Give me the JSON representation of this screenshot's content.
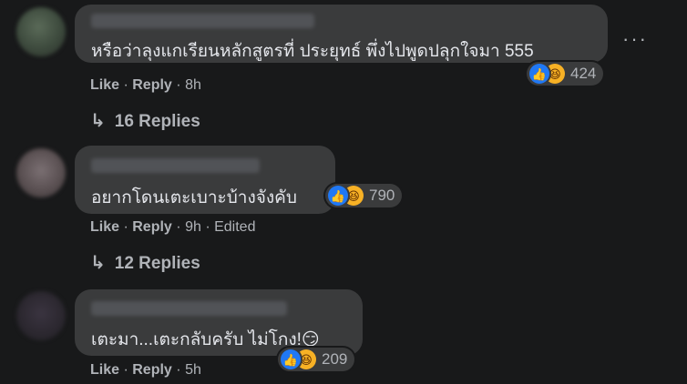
{
  "comments": [
    {
      "text": "หรือว่าลุงแกเรียนหลักสูตรที่ ประยุทธ์ พึ่งไปพูดปลุกใจมา 555",
      "reaction_count": "424",
      "like": "Like",
      "reply": "Reply",
      "time": "8h",
      "replies_label": "16 Replies",
      "more": "···"
    },
    {
      "text": "อยากโดนเตะเบาะบ้างจังคับ",
      "reaction_count": "790",
      "like": "Like",
      "reply": "Reply",
      "time": "9h",
      "edited": "Edited",
      "replies_label": "12 Replies"
    },
    {
      "text": "เตะมา...เตะกลับครับ ไม่โกง!😏",
      "reaction_count": "209",
      "like": "Like",
      "reply": "Reply",
      "time": "5h"
    }
  ],
  "icons": {
    "like": "thumbs-up-icon",
    "haha": "laughing-face-icon",
    "reply_arrow": "reply-arrow-icon",
    "more": "more-options-icon"
  },
  "colors": {
    "background": "#18191a",
    "bubble": "#3a3b3c",
    "text": "#e4e6eb",
    "secondary_text": "#b0b3b8",
    "like_blue": "#2078f4",
    "haha_yellow": "#f7b125"
  }
}
